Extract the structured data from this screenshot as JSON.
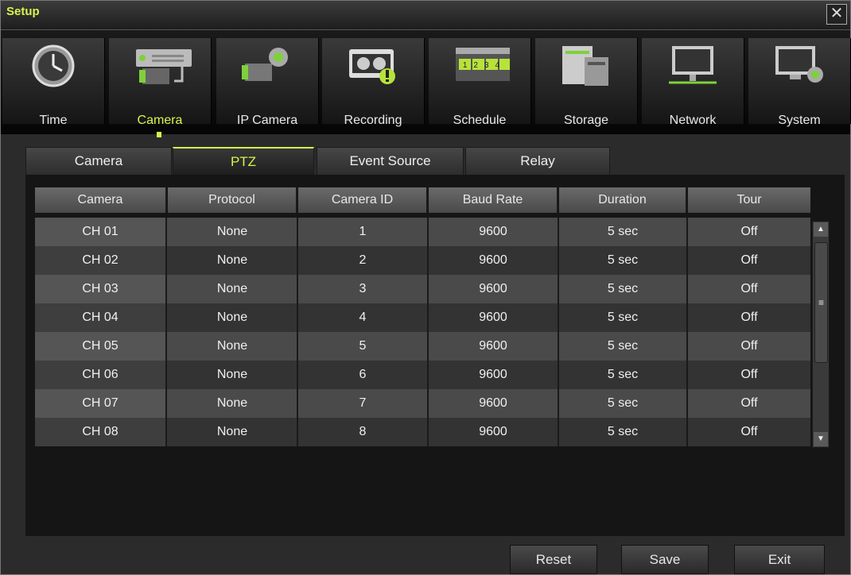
{
  "window": {
    "title": "Setup",
    "close_glyph": "✕"
  },
  "toolbar": {
    "items": [
      {
        "label": "Time",
        "icon": "clock-icon"
      },
      {
        "label": "Camera",
        "icon": "camera-icon"
      },
      {
        "label": "IP Camera",
        "icon": "ip-camera-icon"
      },
      {
        "label": "Recording",
        "icon": "recording-icon"
      },
      {
        "label": "Schedule",
        "icon": "schedule-icon"
      },
      {
        "label": "Storage",
        "icon": "storage-icon"
      },
      {
        "label": "Network",
        "icon": "network-icon"
      },
      {
        "label": "System",
        "icon": "system-icon"
      }
    ],
    "active": "Camera",
    "schedule_digits": "1234"
  },
  "tabs": {
    "items": [
      {
        "label": "Camera"
      },
      {
        "label": "PTZ"
      },
      {
        "label": "Event Source"
      },
      {
        "label": "Relay"
      }
    ],
    "active": "PTZ"
  },
  "table": {
    "columns": [
      "Camera",
      "Protocol",
      "Camera ID",
      "Baud Rate",
      "Duration",
      "Tour"
    ],
    "rows": [
      {
        "camera": "CH 01",
        "protocol": "None",
        "camera_id": "1",
        "baud_rate": "9600",
        "duration": "5 sec",
        "tour": "Off"
      },
      {
        "camera": "CH 02",
        "protocol": "None",
        "camera_id": "2",
        "baud_rate": "9600",
        "duration": "5 sec",
        "tour": "Off"
      },
      {
        "camera": "CH 03",
        "protocol": "None",
        "camera_id": "3",
        "baud_rate": "9600",
        "duration": "5 sec",
        "tour": "Off"
      },
      {
        "camera": "CH 04",
        "protocol": "None",
        "camera_id": "4",
        "baud_rate": "9600",
        "duration": "5 sec",
        "tour": "Off"
      },
      {
        "camera": "CH 05",
        "protocol": "None",
        "camera_id": "5",
        "baud_rate": "9600",
        "duration": "5 sec",
        "tour": "Off"
      },
      {
        "camera": "CH 06",
        "protocol": "None",
        "camera_id": "6",
        "baud_rate": "9600",
        "duration": "5 sec",
        "tour": "Off"
      },
      {
        "camera": "CH 07",
        "protocol": "None",
        "camera_id": "7",
        "baud_rate": "9600",
        "duration": "5 sec",
        "tour": "Off"
      },
      {
        "camera": "CH 08",
        "protocol": "None",
        "camera_id": "8",
        "baud_rate": "9600",
        "duration": "5 sec",
        "tour": "Off"
      }
    ]
  },
  "scrollbar": {
    "up_glyph": "▲",
    "down_glyph": "▼",
    "thumb_glyph": "≡"
  },
  "buttons": {
    "reset": "Reset",
    "save": "Save",
    "exit": "Exit"
  },
  "colors": {
    "accent": "#d9f24c",
    "row_light": "#4a4a4a",
    "row_dark": "#333333",
    "first_col_light": "#555555",
    "first_col_dark": "#3e3e3e"
  }
}
